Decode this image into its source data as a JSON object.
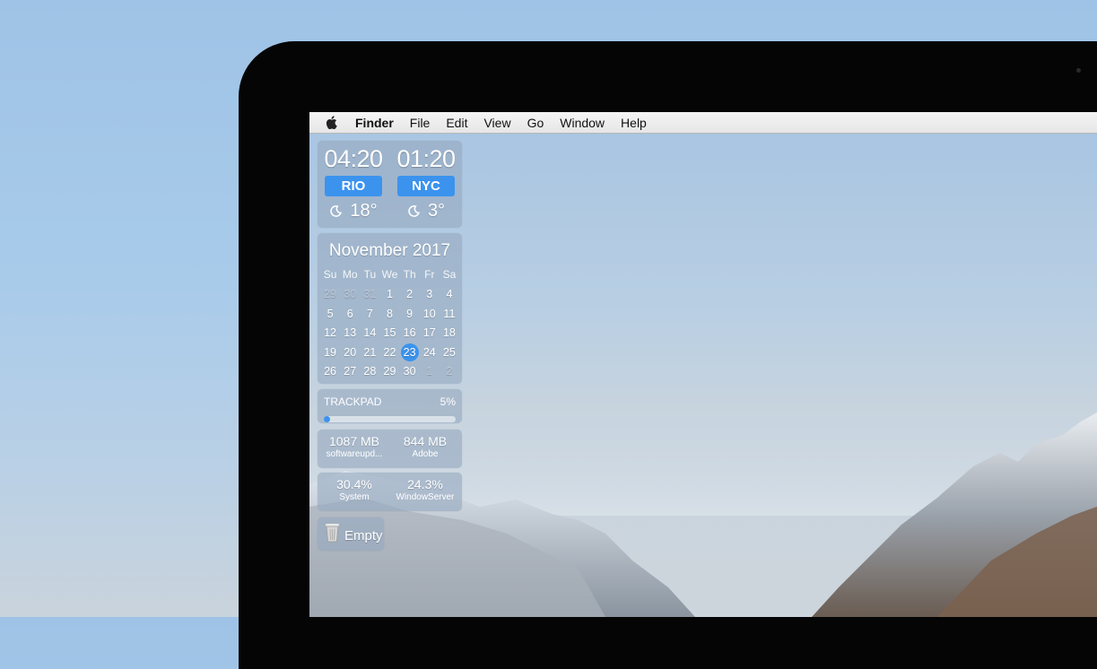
{
  "menubar": {
    "apple_icon": "apple-logo-icon",
    "items": [
      "Finder",
      "File",
      "Edit",
      "View",
      "Go",
      "Window",
      "Help"
    ]
  },
  "clocks": [
    {
      "time": "04:20",
      "city": "RIO",
      "weather_icon": "moon-icon",
      "temp": "18°"
    },
    {
      "time": "01:20",
      "city": "NYC",
      "weather_icon": "moon-icon",
      "temp": "3°"
    }
  ],
  "calendar": {
    "title": "November 2017",
    "weekdays": [
      "Su",
      "Mo",
      "Tu",
      "We",
      "Th",
      "Fr",
      "Sa"
    ],
    "days": [
      "29",
      "30",
      "31",
      "1",
      "2",
      "3",
      "4",
      "5",
      "6",
      "7",
      "8",
      "9",
      "10",
      "11",
      "12",
      "13",
      "14",
      "15",
      "16",
      "17",
      "18",
      "19",
      "20",
      "21",
      "22",
      "23",
      "24",
      "25",
      "26",
      "27",
      "28",
      "29",
      "30",
      "1",
      "2"
    ],
    "muted_indices": [
      0,
      1,
      2,
      33,
      34
    ],
    "today_index": 25
  },
  "trackpad": {
    "label": "TRACKPAD",
    "percent_text": "5%",
    "level": 0.05
  },
  "memory": [
    {
      "value": "1087 MB",
      "name": "softwareupd..."
    },
    {
      "value": "844 MB",
      "name": "Adobe"
    }
  ],
  "cpu": [
    {
      "value": "30.4%",
      "name": "System"
    },
    {
      "value": "24.3%",
      "name": "WindowServer"
    }
  ],
  "trash": {
    "icon": "trash-icon",
    "label": "Empty"
  },
  "colors": {
    "accent": "#3b93ee",
    "bezel": "#050505",
    "menubar": "#ececec"
  }
}
